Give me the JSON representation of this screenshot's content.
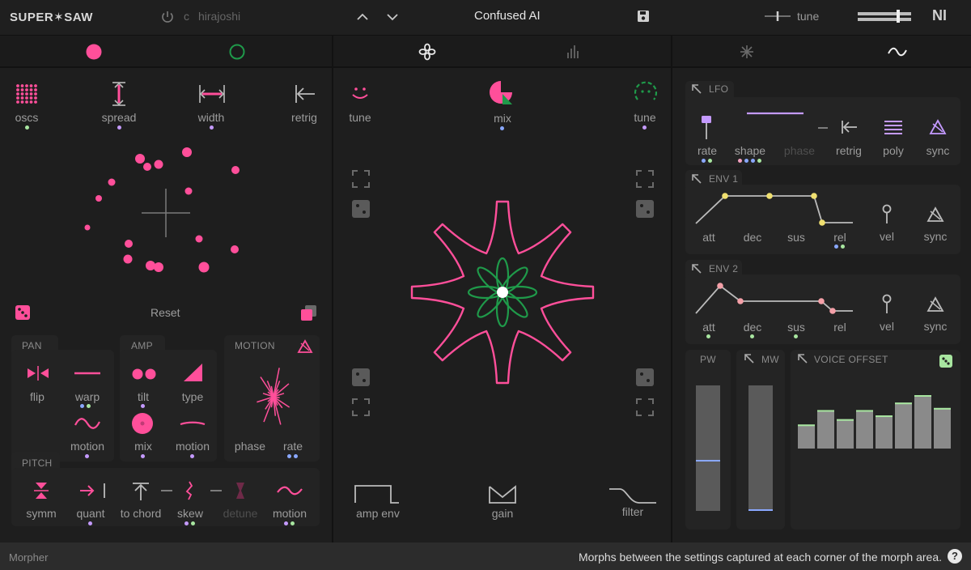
{
  "header": {
    "logo": "SUPER✶SAW",
    "key": "c",
    "scale": "hirajoshi",
    "preset_name": "Confused AI",
    "tune_label": "tune",
    "ni_logo": "NI"
  },
  "tabs": {
    "left": [
      "circle-filled",
      "circle-outline"
    ],
    "center": [
      "flower",
      "bars"
    ],
    "right": [
      "asterisk",
      "wave"
    ]
  },
  "osc": {
    "oscs": "oscs",
    "spread": "spread",
    "width": "width",
    "retrig": "retrig",
    "reset": "Reset"
  },
  "pan": {
    "title": "PAN",
    "flip": "flip",
    "warp": "warp",
    "motion": "motion"
  },
  "amp": {
    "title": "AMP",
    "tilt": "tilt",
    "type": "type",
    "mix": "mix",
    "motion": "motion"
  },
  "motion": {
    "title": "MOTION",
    "phase": "phase",
    "rate": "rate"
  },
  "pitch": {
    "title": "PITCH",
    "symm": "symm",
    "quant": "quant",
    "to_chord": "to chord",
    "skew": "skew",
    "detune": "detune",
    "motion": "motion"
  },
  "morph": {
    "tune_left": "tune",
    "mix": "mix",
    "tune_right": "tune",
    "amp_env": "amp env",
    "gain": "gain",
    "filter": "filter"
  },
  "lfo": {
    "title": "LFO",
    "rate": "rate",
    "shape": "shape",
    "phase": "phase",
    "retrig": "retrig",
    "poly": "poly",
    "sync": "sync"
  },
  "env1": {
    "title": "ENV 1",
    "att": "att",
    "dec": "dec",
    "sus": "sus",
    "rel": "rel",
    "vel": "vel",
    "sync": "sync"
  },
  "env2": {
    "title": "ENV 2",
    "att": "att",
    "dec": "dec",
    "sus": "sus",
    "rel": "rel",
    "vel": "vel",
    "sync": "sync"
  },
  "sliders": {
    "pw": "PW",
    "mw": "MW",
    "voice_offset": "VOICE OFFSET",
    "pw_value": 0.4,
    "mw_value": 0.0,
    "voice_offset_values": [
      0.45,
      0.72,
      0.55,
      0.72,
      0.62,
      0.86,
      1.0,
      0.76
    ]
  },
  "status": {
    "section": "Morpher",
    "hint": "Morphs between the settings captured at each corner of the morph area.",
    "help": "?"
  },
  "colors": {
    "pink": "#ff4f9a",
    "green": "#1f9a4a",
    "purple": "#b98cff",
    "mod_blue": "#8aa8ff",
    "mod_green": "#a8e6a0",
    "mod_yellow": "#f0e070",
    "mod_purple": "#c49aff"
  }
}
